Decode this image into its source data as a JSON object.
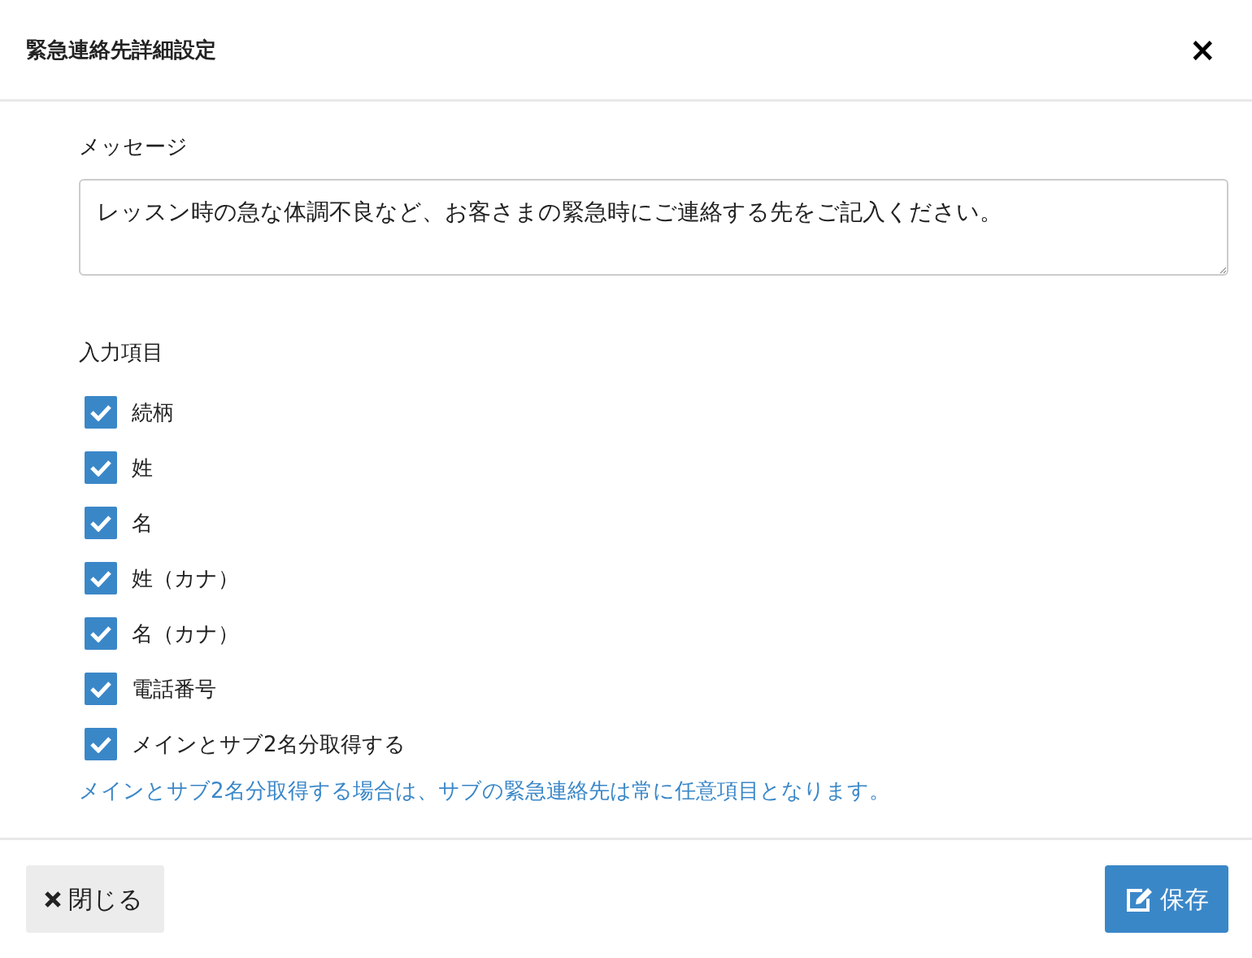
{
  "dialog": {
    "title": "緊急連絡先詳細設定",
    "close_icon": "×"
  },
  "message": {
    "label": "メッセージ",
    "value": "レッスン時の急な体調不良など、お客さまの緊急時にご連絡する先をご記入ください。"
  },
  "fields": {
    "label": "入力項目",
    "items": [
      {
        "label": "続柄",
        "checked": true
      },
      {
        "label": "姓",
        "checked": true
      },
      {
        "label": "名",
        "checked": true
      },
      {
        "label": "姓（カナ）",
        "checked": true
      },
      {
        "label": "名（カナ）",
        "checked": true
      },
      {
        "label": "電話番号",
        "checked": true
      },
      {
        "label": "メインとサブ2名分取得する",
        "checked": true
      }
    ],
    "note": "メインとサブ2名分取得する場合は、サブの緊急連絡先は常に任意項目となります。"
  },
  "footer": {
    "close_button": "閉じる",
    "save_button": "保存"
  }
}
